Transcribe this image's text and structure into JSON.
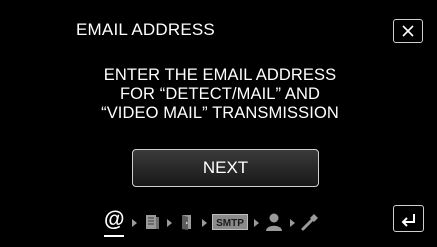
{
  "header": {
    "title": "EMAIL ADDRESS",
    "close_icon": "close-icon"
  },
  "message": {
    "lines": [
      "ENTER THE EMAIL ADDRESS",
      "FOR “DETECT/MAIL” AND",
      "“VIDEO MAIL” TRANSMISSION"
    ]
  },
  "next_button": {
    "label": "NEXT"
  },
  "steps": {
    "items": [
      {
        "icon": "at-icon",
        "label": "@",
        "active": true
      },
      {
        "icon": "book-icon",
        "active": false
      },
      {
        "icon": "door-icon",
        "active": false
      },
      {
        "icon": "smtp-icon",
        "label": "SMTP",
        "active": false
      },
      {
        "icon": "user-icon",
        "active": false
      },
      {
        "icon": "tool-icon",
        "active": false
      }
    ]
  },
  "back_button": {
    "icon": "back-icon"
  }
}
